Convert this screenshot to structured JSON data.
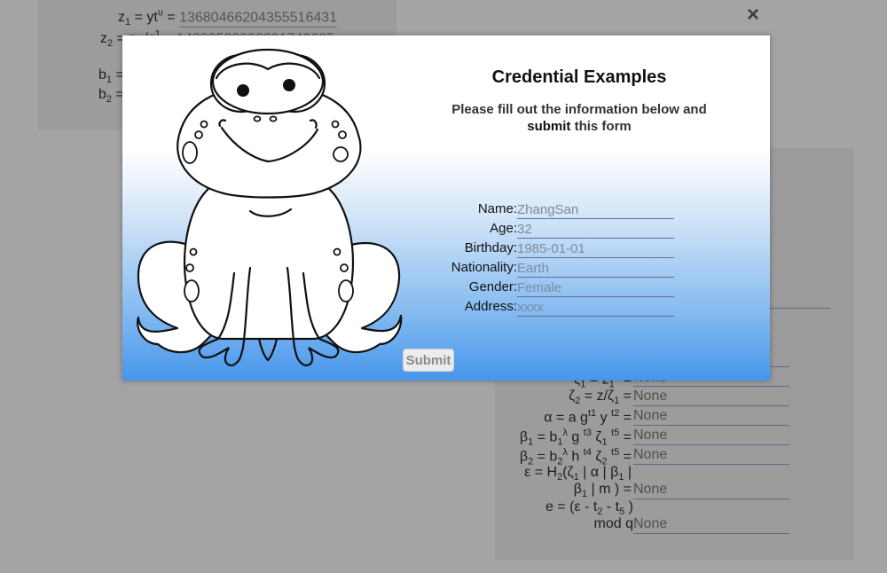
{
  "background": {
    "top_rows": [
      {
        "label_html": "z<sub>1</sub> = yt<sup>υ</sup> =",
        "value": "13680466204355516431"
      },
      {
        "label_html": "z<sub>2</sub> = zu/z<sup>1</sup> =",
        "value": "14239580893291740635"
      },
      {
        "label_html": "b<sub>1</sub> =",
        "value": ""
      },
      {
        "label_html": "b<sub>2</sub> =",
        "value": ""
      }
    ],
    "right_rows": [
      {
        "label_html": "ζ<sub>1</sub> = z<sub>1</sub><sup>λ</sup> =",
        "value": "None"
      },
      {
        "label_html": "ζ<sub>2</sub> = z/ζ<sub>1</sub> =",
        "value": "None"
      },
      {
        "label_html": "α = a g<sup>t1</sup> y <sup>t2</sup> =",
        "value": "None"
      },
      {
        "label_html": "β<sub>1</sub> = b<sub>1</sub><sup>λ</sup> g <sup>t3</sup> ζ<sub>1</sub> <sup>t5</sup> =",
        "value": "None"
      },
      {
        "label_html": "β<sub>2</sub> = b<sub>2</sub><sup>λ</sup> h <sup>t4</sup> ζ<sub>2</sub> <sup>t5</sup> =",
        "value": "None"
      },
      {
        "label_line1_html": "ε = H<sub>2</sub>(ζ<sub>1</sub> | α | β<sub>1</sub> |",
        "label_html": "β<sub>1</sub> | m ) =",
        "value": "None"
      },
      {
        "label_line1_html": "e = (ε - t<sub>2</sub> - t<sub>5</sub> )",
        "label_html": "mod q",
        "value": "None"
      }
    ]
  },
  "close_icon": "×",
  "modal": {
    "title": "Credential Examples",
    "subtitle_part1": "Please fill out the information below and ",
    "subtitle_bold": "submit",
    "subtitle_part2": " this form",
    "image_name": "frog-illustration",
    "fields": [
      {
        "label": "Name:",
        "placeholder": "ZhangSan"
      },
      {
        "label": "Age:",
        "placeholder": "32"
      },
      {
        "label": "Birthday:",
        "placeholder": "1985-01-01"
      },
      {
        "label": "Nationality:",
        "placeholder": "Earth"
      },
      {
        "label": "Gender:",
        "placeholder": "Female"
      },
      {
        "label": "Address:",
        "placeholder": "xxxx"
      }
    ],
    "submit_label": "Submit"
  },
  "colors": {
    "overlay": "#a4a4a4",
    "gradient_bottom": "#4796ec",
    "field_underline": "#5e6f8e"
  }
}
